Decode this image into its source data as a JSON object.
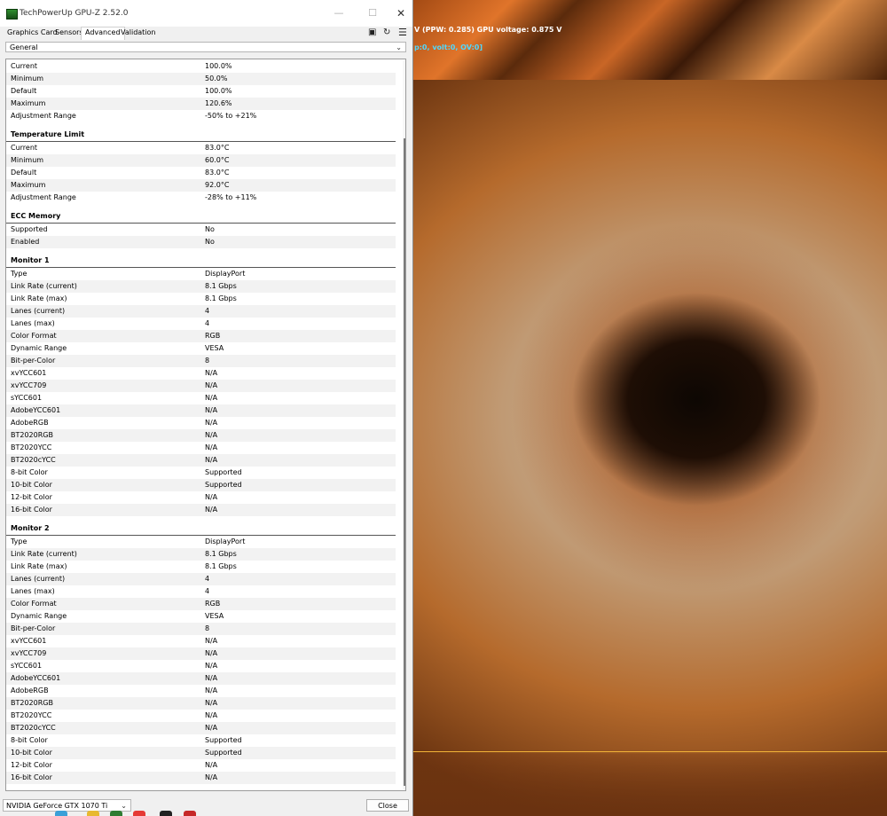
{
  "window": {
    "title": "TechPowerUp GPU-Z 2.52.0",
    "controls": {
      "minimize": "—",
      "maximize": "☐",
      "close": "✕"
    }
  },
  "tabs": [
    {
      "label": "Graphics Card"
    },
    {
      "label": "Sensors"
    },
    {
      "label": "Advanced",
      "active": true
    },
    {
      "label": "Validation"
    }
  ],
  "toolbar_icons": {
    "camera": "camera-icon",
    "refresh": "refresh-icon",
    "menu": "menu-icon"
  },
  "section_select": {
    "value": "General"
  },
  "top_group": [
    {
      "label": "Current",
      "value": "100.0%"
    },
    {
      "label": "Minimum",
      "value": "50.0%"
    },
    {
      "label": "Default",
      "value": "100.0%"
    },
    {
      "label": "Maximum",
      "value": "120.6%"
    },
    {
      "label": "Adjustment Range",
      "value": "-50% to +21%"
    }
  ],
  "temperature_limit": {
    "title": "Temperature Limit",
    "rows": [
      {
        "label": "Current",
        "value": "83.0°C"
      },
      {
        "label": "Minimum",
        "value": "60.0°C"
      },
      {
        "label": "Default",
        "value": "83.0°C"
      },
      {
        "label": "Maximum",
        "value": "92.0°C"
      },
      {
        "label": "Adjustment Range",
        "value": "-28% to +11%"
      }
    ]
  },
  "ecc_memory": {
    "title": "ECC Memory",
    "rows": [
      {
        "label": "Supported",
        "value": "No"
      },
      {
        "label": "Enabled",
        "value": "No"
      }
    ]
  },
  "monitor_1": {
    "title": "Monitor 1",
    "rows": [
      {
        "label": "Type",
        "value": "DisplayPort"
      },
      {
        "label": "Link Rate (current)",
        "value": "8.1 Gbps"
      },
      {
        "label": "Link Rate (max)",
        "value": "8.1 Gbps"
      },
      {
        "label": "Lanes (current)",
        "value": "4"
      },
      {
        "label": "Lanes (max)",
        "value": "4"
      },
      {
        "label": "Color Format",
        "value": "RGB"
      },
      {
        "label": "Dynamic Range",
        "value": "VESA"
      },
      {
        "label": "Bit-per-Color",
        "value": "8"
      },
      {
        "label": "xvYCC601",
        "value": "N/A"
      },
      {
        "label": "xvYCC709",
        "value": "N/A"
      },
      {
        "label": "sYCC601",
        "value": "N/A"
      },
      {
        "label": "AdobeYCC601",
        "value": "N/A"
      },
      {
        "label": "AdobeRGB",
        "value": "N/A"
      },
      {
        "label": "BT2020RGB",
        "value": "N/A"
      },
      {
        "label": "BT2020YCC",
        "value": "N/A"
      },
      {
        "label": "BT2020cYCC",
        "value": "N/A"
      },
      {
        "label": "8-bit Color",
        "value": "Supported"
      },
      {
        "label": "10-bit Color",
        "value": "Supported"
      },
      {
        "label": "12-bit Color",
        "value": "N/A"
      },
      {
        "label": "16-bit Color",
        "value": "N/A"
      }
    ]
  },
  "monitor_2": {
    "title": "Monitor 2",
    "rows": [
      {
        "label": "Type",
        "value": "DisplayPort"
      },
      {
        "label": "Link Rate (current)",
        "value": "8.1 Gbps"
      },
      {
        "label": "Link Rate (max)",
        "value": "8.1 Gbps"
      },
      {
        "label": "Lanes (current)",
        "value": "4"
      },
      {
        "label": "Lanes (max)",
        "value": "4"
      },
      {
        "label": "Color Format",
        "value": "RGB"
      },
      {
        "label": "Dynamic Range",
        "value": "VESA"
      },
      {
        "label": "Bit-per-Color",
        "value": "8"
      },
      {
        "label": "xvYCC601",
        "value": "N/A"
      },
      {
        "label": "xvYCC709",
        "value": "N/A"
      },
      {
        "label": "sYCC601",
        "value": "N/A"
      },
      {
        "label": "AdobeYCC601",
        "value": "N/A"
      },
      {
        "label": "AdobeRGB",
        "value": "N/A"
      },
      {
        "label": "BT2020RGB",
        "value": "N/A"
      },
      {
        "label": "BT2020YCC",
        "value": "N/A"
      },
      {
        "label": "BT2020cYCC",
        "value": "N/A"
      },
      {
        "label": "8-bit Color",
        "value": "Supported"
      },
      {
        "label": "10-bit Color",
        "value": "Supported"
      },
      {
        "label": "12-bit Color",
        "value": "N/A"
      },
      {
        "label": "16-bit Color",
        "value": "N/A"
      }
    ]
  },
  "status_bar": {
    "gpu_select": "NVIDIA GeForce GTX 1070 Ti",
    "close_label": "Close"
  },
  "desktop_overlay": {
    "line1": "V (PPW: 0.285) GPU voltage: 0.875 V",
    "line2": "p:0, volt:0, OV:0]"
  },
  "colors": {
    "window_bg": "#f0f0f0",
    "row_alt": "#f2f2f2",
    "overlay_primary": "#ffffff",
    "overlay_secondary": "#4fd8ff",
    "monitor_trace": "#f2b338"
  }
}
